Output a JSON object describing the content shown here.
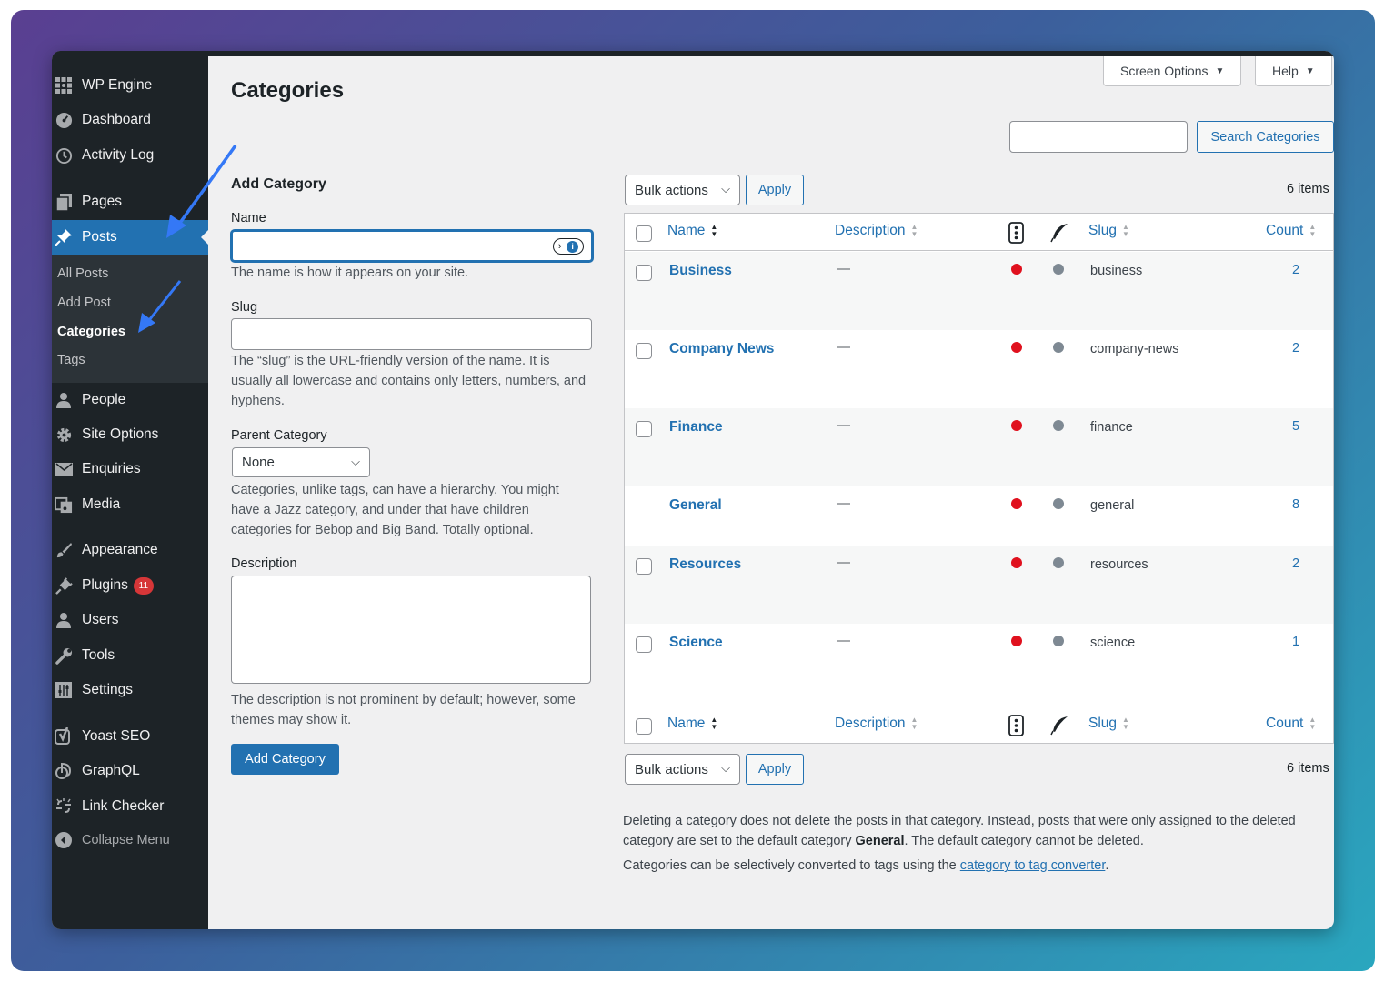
{
  "sidebar": {
    "items": [
      {
        "label": "WP Engine",
        "icon": "wp-engine-icon"
      },
      {
        "label": "Dashboard",
        "icon": "dashboard-icon"
      },
      {
        "label": "Activity Log",
        "icon": "history-icon"
      },
      {
        "label": "Pages",
        "icon": "pages-icon"
      },
      {
        "label": "Posts",
        "icon": "pushpin-icon",
        "active": true
      },
      {
        "label": "People",
        "icon": "person-icon"
      },
      {
        "label": "Site Options",
        "icon": "gear-icon"
      },
      {
        "label": "Enquiries",
        "icon": "envelope-icon"
      },
      {
        "label": "Media",
        "icon": "media-icon"
      },
      {
        "label": "Appearance",
        "icon": "brush-icon"
      },
      {
        "label": "Plugins",
        "icon": "plugin-icon",
        "badge": "11"
      },
      {
        "label": "Users",
        "icon": "users-icon"
      },
      {
        "label": "Tools",
        "icon": "wrench-icon"
      },
      {
        "label": "Settings",
        "icon": "settings-icon"
      },
      {
        "label": "Yoast SEO",
        "icon": "yoast-icon"
      },
      {
        "label": "GraphQL",
        "icon": "graphql-icon"
      },
      {
        "label": "Link Checker",
        "icon": "link-checker-icon"
      },
      {
        "label": "Collapse Menu",
        "icon": "collapse-icon"
      }
    ],
    "submenu": [
      "All Posts",
      "Add Post",
      "Categories",
      "Tags"
    ]
  },
  "header": {
    "title": "Categories",
    "screen_options": "Screen Options",
    "help": "Help",
    "search_button": "Search Categories",
    "search_value": ""
  },
  "form": {
    "heading": "Add Category",
    "name_label": "Name",
    "name_value": "",
    "name_help": "The name is how it appears on your site.",
    "slug_label": "Slug",
    "slug_value": "",
    "slug_help": "The “slug” is the URL-friendly version of the name. It is usually all lowercase and contains only letters, numbers, and hyphens.",
    "parent_label": "Parent Category",
    "parent_value": "None",
    "parent_help": "Categories, unlike tags, can have a hierarchy. You might have a Jazz category, and under that have children categories for Bebop and Big Band. Totally optional.",
    "description_label": "Description",
    "description_help": "The description is not prominent by default; however, some themes may show it.",
    "submit": "Add Category"
  },
  "list": {
    "bulk_actions": "Bulk actions",
    "apply": "Apply",
    "items_count": "6 items",
    "columns": {
      "name": "Name",
      "description": "Description",
      "slug": "Slug",
      "count": "Count"
    },
    "rows": [
      {
        "name": "Business",
        "description": "—",
        "slug": "business",
        "count": "2",
        "checkbox": true
      },
      {
        "name": "Company News",
        "description": "—",
        "slug": "company-news",
        "count": "2",
        "checkbox": true
      },
      {
        "name": "Finance",
        "description": "—",
        "slug": "finance",
        "count": "5",
        "checkbox": true
      },
      {
        "name": "General",
        "description": "—",
        "slug": "general",
        "count": "8",
        "checkbox": false
      },
      {
        "name": "Resources",
        "description": "—",
        "slug": "resources",
        "count": "2",
        "checkbox": true
      },
      {
        "name": "Science",
        "description": "—",
        "slug": "science",
        "count": "1",
        "checkbox": true
      }
    ]
  },
  "notes": {
    "line1_a": "Deleting a category does not delete the posts in that category. Instead, posts that were only assigned to the deleted category are set to the default category ",
    "line1_bold": "General",
    "line1_b": ". The default category cannot be deleted.",
    "line2_a": "Categories can be selectively converted to tags using the ",
    "line2_link": "category to tag converter",
    "line2_b": "."
  },
  "colors": {
    "accent": "#2271b1",
    "sidebar_bg": "#1d2327",
    "seo_status_red": "#e0111e",
    "readability_grey": "#7e8993",
    "annotation_arrow": "#3478f6"
  }
}
